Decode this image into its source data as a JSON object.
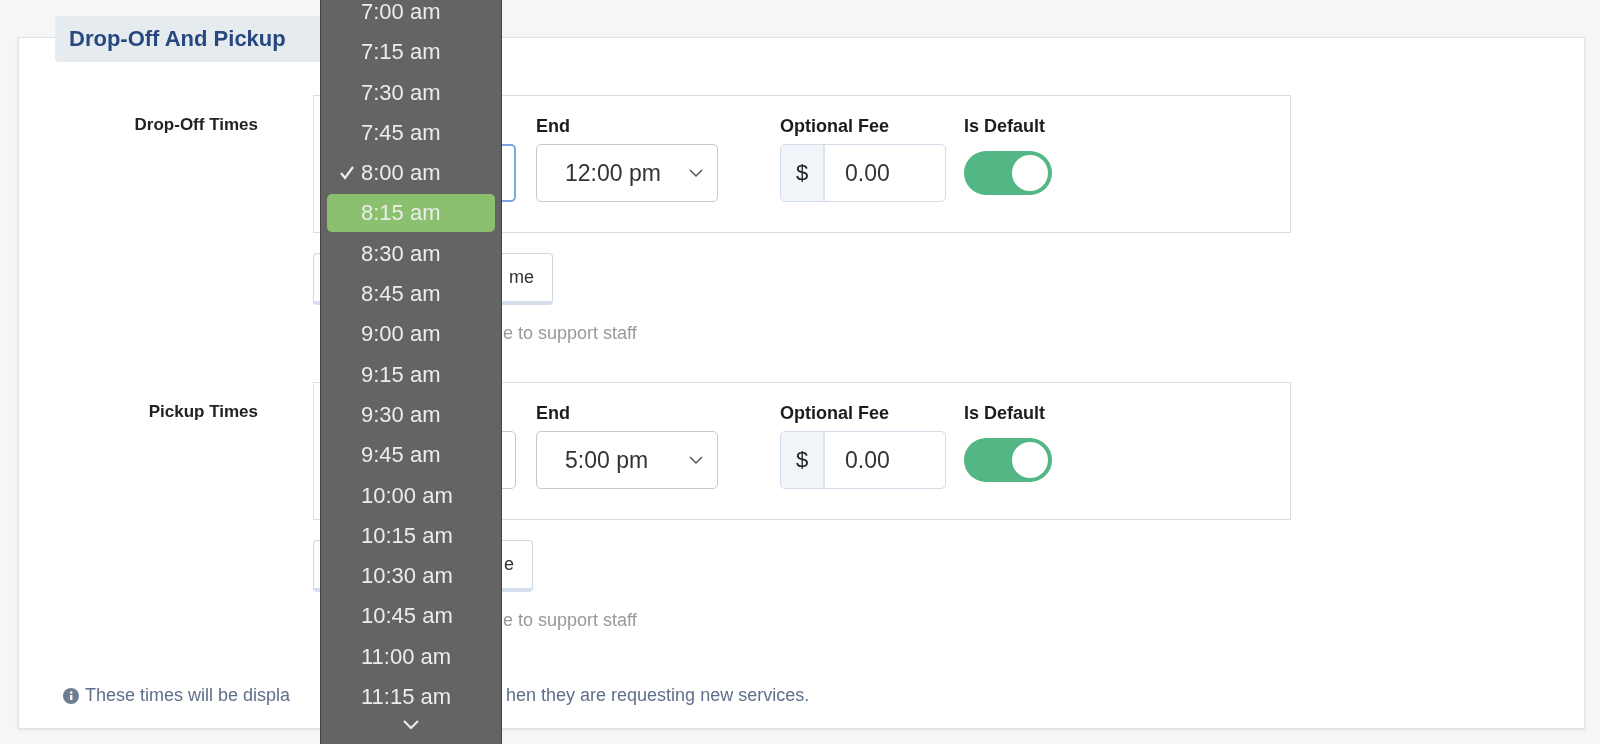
{
  "section": {
    "title": "Drop-Off And Pickup"
  },
  "groups": [
    {
      "label": "Drop-Off Times",
      "start_focused": true,
      "end_label": "End",
      "end_value": "12:00 pm",
      "fee_label": "Optional Fee",
      "currency": "$",
      "fee": "0.00",
      "default_label": "Is Default",
      "is_default": true,
      "add_button": "me",
      "note": "e to support staff"
    },
    {
      "label": "Pickup Times",
      "start_focused": false,
      "end_label": "End",
      "end_value": "5:00 pm",
      "fee_label": "Optional Fee",
      "currency": "$",
      "fee": "0.00",
      "default_label": "Is Default",
      "is_default": true,
      "add_button": "e",
      "note": "e to support staff"
    }
  ],
  "info": {
    "text_before": "These times will be displa",
    "text_after": "hen they are requesting new services."
  },
  "dropdown": {
    "options": [
      {
        "label": "7:00 am",
        "checked": false,
        "highlighted": false
      },
      {
        "label": "7:15 am",
        "checked": false,
        "highlighted": false
      },
      {
        "label": "7:30 am",
        "checked": false,
        "highlighted": false
      },
      {
        "label": "7:45 am",
        "checked": false,
        "highlighted": false
      },
      {
        "label": "8:00 am",
        "checked": true,
        "highlighted": false
      },
      {
        "label": "8:15 am",
        "checked": false,
        "highlighted": true
      },
      {
        "label": "8:30 am",
        "checked": false,
        "highlighted": false
      },
      {
        "label": "8:45 am",
        "checked": false,
        "highlighted": false
      },
      {
        "label": "9:00 am",
        "checked": false,
        "highlighted": false
      },
      {
        "label": "9:15 am",
        "checked": false,
        "highlighted": false
      },
      {
        "label": "9:30 am",
        "checked": false,
        "highlighted": false
      },
      {
        "label": "9:45 am",
        "checked": false,
        "highlighted": false
      },
      {
        "label": "10:00 am",
        "checked": false,
        "highlighted": false
      },
      {
        "label": "10:15 am",
        "checked": false,
        "highlighted": false
      },
      {
        "label": "10:30 am",
        "checked": false,
        "highlighted": false
      },
      {
        "label": "10:45 am",
        "checked": false,
        "highlighted": false
      },
      {
        "label": "11:00 am",
        "checked": false,
        "highlighted": false
      },
      {
        "label": "11:15 am",
        "checked": false,
        "highlighted": false
      }
    ]
  }
}
